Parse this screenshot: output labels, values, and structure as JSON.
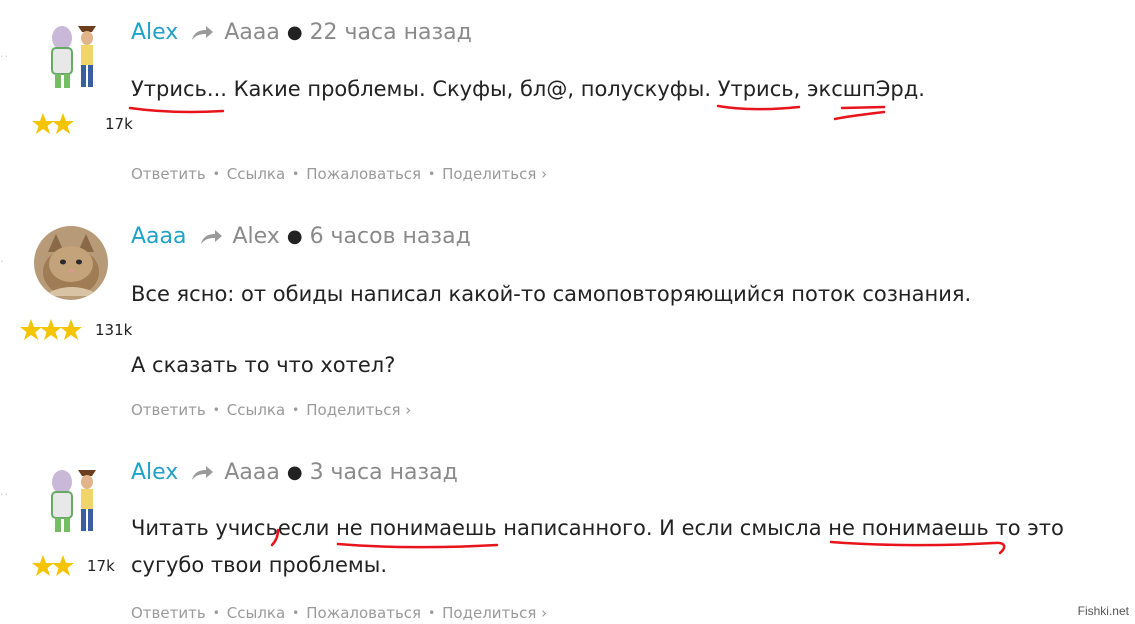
{
  "comments": [
    {
      "author": "Alex",
      "target": "Аааа",
      "time": "22 часа назад",
      "rating": "17k",
      "avatar": "toy-story-avatar",
      "paragraphs": [
        {
          "segments": [
            "Утрись...",
            " Какие проблемы. Скуфы, бл@, полускуфы. ",
            "Утрись,",
            " ",
            "эксш",
            "пЭрд",
            "."
          ]
        }
      ],
      "actions": [
        "Ответить",
        "Ссылка",
        "Пожаловаться",
        "Поделиться ›"
      ]
    },
    {
      "author": "Аааа",
      "target": "Alex",
      "time": "6 часов назад",
      "rating": "131k",
      "avatar": "kitten-avatar",
      "paragraphs": [
        {
          "text": "Все ясно: от обиды написал какой-то самоповторяющийся поток сознания."
        },
        {
          "text": "А сказать то что хотел?"
        }
      ],
      "actions": [
        "Ответить",
        "Ссылка",
        "Поделиться ›"
      ]
    },
    {
      "author": "Alex",
      "target": "Аааа",
      "time": "3 часа назад",
      "rating": "17k",
      "avatar": "toy-story-avatar",
      "paragraphs": [
        {
          "segments": [
            "Читать учись",
            "",
            "если ",
            "не понимаешь",
            " написанного. И если смысла ",
            "не понимаешь",
            " то это"
          ]
        },
        {
          "text": "сугубо твои проблемы."
        }
      ],
      "actions": [
        "Ответить",
        "Ссылка",
        "Пожаловаться",
        "Поделиться ›"
      ]
    }
  ],
  "watermark": "Fishki.net",
  "colors": {
    "author": "#1fa2c8",
    "muted": "#8a8a8a",
    "actions": "#9a9a9a",
    "star": "#f5c400",
    "annotation": "#e8141b"
  }
}
